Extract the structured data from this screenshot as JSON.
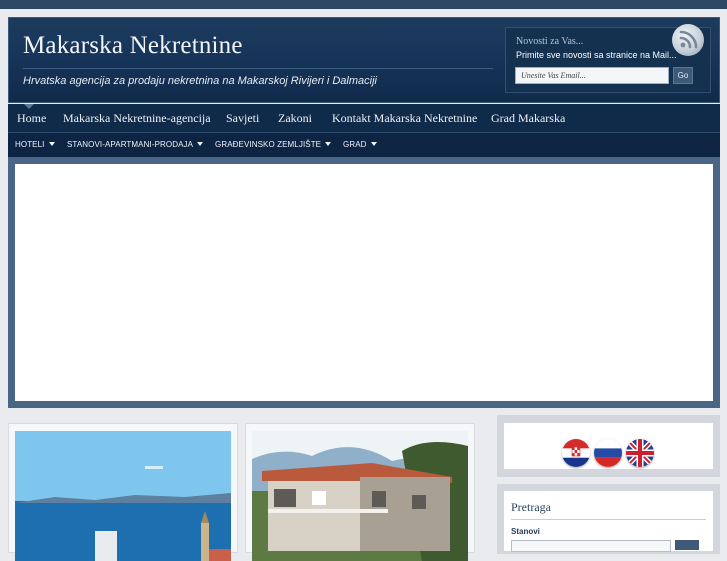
{
  "header": {
    "site_title": "Makarska Nekretnine",
    "tagline": "Hrvatska agencija za prodaju nekretnina na Makarskoj Rivijeri i Dalmaciji"
  },
  "newsletter": {
    "title": "Novosti za Vas...",
    "text": "Primite sve novosti sa stranice na Mail...",
    "email_placeholder": "Unesite Vas Email...",
    "button_label": "Go"
  },
  "main_nav": {
    "items": [
      {
        "label": "Home"
      },
      {
        "label": "Makarska Nekretnine-agencija"
      },
      {
        "label": "Savjeti"
      },
      {
        "label": "Zakoni"
      },
      {
        "label": "Kontakt Makarska Nekretnine"
      },
      {
        "label": "Grad Makarska"
      }
    ]
  },
  "sub_nav": {
    "items": [
      {
        "label": "HOTELI"
      },
      {
        "label": "STANOVI-APARTMANI-PRODAJA"
      },
      {
        "label": "GRAĐEVINSKO ZEMLJIŠTE"
      },
      {
        "label": "GRAD"
      }
    ]
  },
  "sidebar": {
    "languages": [
      {
        "name": "Croatian",
        "icon": "croatia-flag-icon"
      },
      {
        "name": "Russian",
        "icon": "russia-flag-icon"
      },
      {
        "name": "English",
        "icon": "uk-flag-icon"
      }
    ],
    "search": {
      "title": "Pretraga",
      "label": "Stanovi"
    }
  },
  "posts": [
    {
      "image": "seaside-town-photo"
    },
    {
      "image": "stone-house-photo"
    }
  ],
  "colors": {
    "header_bg": "#17355a",
    "nav_bg": "#102a4a",
    "accent": "#4a6686",
    "page_bg": "#e9ebef"
  }
}
